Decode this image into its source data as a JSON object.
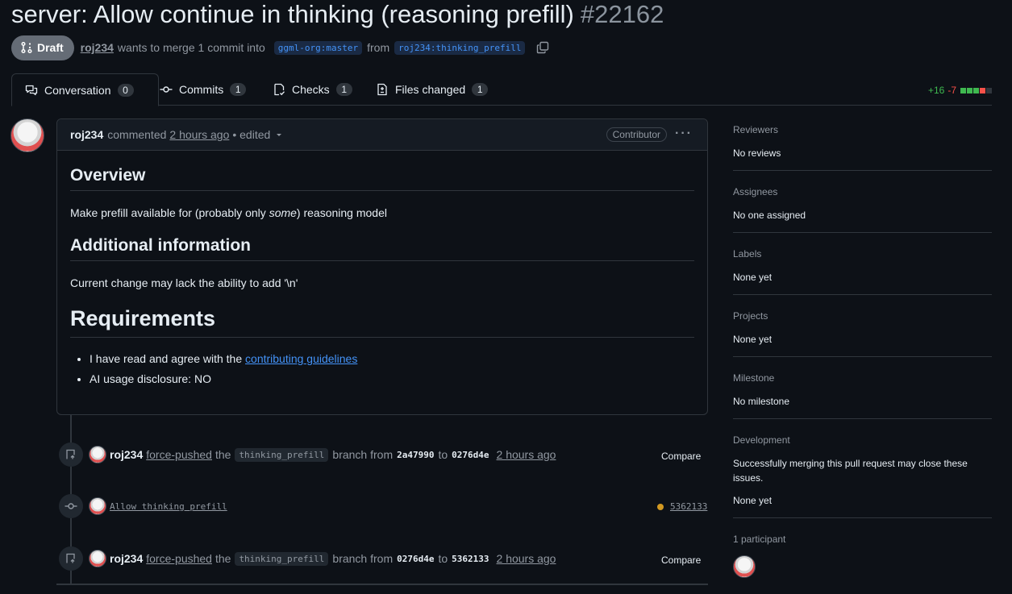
{
  "pr": {
    "title": "server: Allow continue in thinking (reasoning prefill)",
    "number": "#22162",
    "status": "Draft",
    "author": "roj234",
    "merge_text": "wants to merge 1 commit into",
    "base_branch": "ggml-org:master",
    "from_text": "from",
    "head_branch": "roj234:thinking_prefill"
  },
  "tabs": [
    {
      "label": "Conversation",
      "count": "0",
      "icon": "comment-discussion-icon"
    },
    {
      "label": "Commits",
      "count": "1",
      "icon": "git-commit-icon"
    },
    {
      "label": "Checks",
      "count": "1",
      "icon": "checklist-icon"
    },
    {
      "label": "Files changed",
      "count": "1",
      "icon": "file-diff-icon"
    }
  ],
  "diffstat": {
    "additions": "+16",
    "deletions": "-7"
  },
  "comment": {
    "author": "roj234",
    "action": "commented",
    "time": "2 hours ago",
    "edited": "• edited",
    "role": "Contributor",
    "overview_heading": "Overview",
    "overview_pre": "Make prefill available for (probably only ",
    "overview_em": "some",
    "overview_post": ") reasoning model",
    "additional_heading": "Additional information",
    "additional_text": "Current change may lack the ability to add '\\n'",
    "requirements_heading": "Requirements",
    "req1_pre": "I have read and agree with the ",
    "req1_link": "contributing guidelines",
    "req2": "AI usage disclosure: NO"
  },
  "timeline": [
    {
      "who": "roj234",
      "action": "force-pushed",
      "the": "the",
      "branch": "thinking_prefill",
      "mid": "branch from",
      "from_sha": "2a47990",
      "to": "to",
      "to_sha": "0276d4e",
      "time": "2 hours ago",
      "compare": "Compare"
    },
    {
      "commit_msg": "Allow thinking prefill",
      "sha": "5362133"
    },
    {
      "who": "roj234",
      "action": "force-pushed",
      "the": "the",
      "branch": "thinking_prefill",
      "mid": "branch from",
      "from_sha": "0276d4e",
      "to": "to",
      "to_sha": "5362133",
      "time": "2 hours ago",
      "compare": "Compare"
    }
  ],
  "sidebar": {
    "reviewers": {
      "title": "Reviewers",
      "value": "No reviews"
    },
    "assignees": {
      "title": "Assignees",
      "value": "No one assigned"
    },
    "labels": {
      "title": "Labels",
      "value": "None yet"
    },
    "projects": {
      "title": "Projects",
      "value": "None yet"
    },
    "milestone": {
      "title": "Milestone",
      "value": "No milestone"
    },
    "development": {
      "title": "Development",
      "value": "Successfully merging this pull request may close these issues.",
      "value2": "None yet"
    },
    "participants": {
      "title": "1 participant"
    }
  }
}
